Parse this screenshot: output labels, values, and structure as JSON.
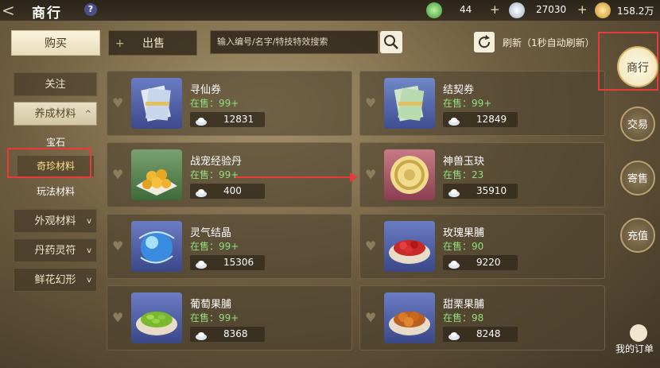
{
  "header": {
    "back_glyph": "<",
    "title": "商行",
    "help_glyph": "?",
    "currencies": [
      {
        "icon": "green-jade-coin-icon",
        "amount": "44",
        "plus": "+"
      },
      {
        "icon": "silver-ingot-icon",
        "amount": "27030",
        "plus": "+"
      },
      {
        "icon": "gold-coin-icon",
        "amount": "158.2万",
        "plus": "+"
      }
    ]
  },
  "toolbar": {
    "buy_label": "购买",
    "sell_plus": "+",
    "sell_label": "出售",
    "search_placeholder": "输入编号/名字/特技特效搜索",
    "refresh_label": "刷新（1秒自动刷新）"
  },
  "categories": {
    "follow": "关注",
    "growth": "养成材料",
    "growth_arrow": "^",
    "subs": [
      "宝石",
      "奇珍材料",
      "玩法材料"
    ],
    "active_sub": "奇珍材料",
    "appearance": "外观材料",
    "medicine": "丹药灵符",
    "flower": "鲜花幻形",
    "collapsed_arrow": "v"
  },
  "stock_prefix": "在售：",
  "items": [
    {
      "name": "寻仙券",
      "stock": "99+",
      "price": "12831",
      "icon": "ticket-bundle-icon"
    },
    {
      "name": "结契券",
      "stock": "99+",
      "price": "12849",
      "icon": "contract-ticket-icon"
    },
    {
      "name": "战宠经验丹",
      "stock": "99+",
      "price": "400",
      "icon": "golden-pills-icon"
    },
    {
      "name": "神兽玉玦",
      "stock": "23",
      "price": "35910",
      "icon": "jade-disc-icon"
    },
    {
      "name": "灵气结晶",
      "stock": "99+",
      "price": "15306",
      "icon": "crystal-orb-icon"
    },
    {
      "name": "玫瑰果脯",
      "stock": "90",
      "price": "9220",
      "icon": "rose-fruit-bowl-icon"
    },
    {
      "name": "葡萄果脯",
      "stock": "99+",
      "price": "8368",
      "icon": "grape-fruit-bowl-icon"
    },
    {
      "name": "甜栗果脯",
      "stock": "98",
      "price": "8248",
      "icon": "chestnut-bowl-icon"
    }
  ],
  "side_nav": {
    "market": "商行",
    "trade": "交易",
    "consign": "寄售",
    "recharge": "充值",
    "orders": "我的订单"
  },
  "colors": {
    "stock_green": "#8fe07a",
    "highlight_red": "#e83a3a",
    "active_gold": "#ffe08a"
  }
}
